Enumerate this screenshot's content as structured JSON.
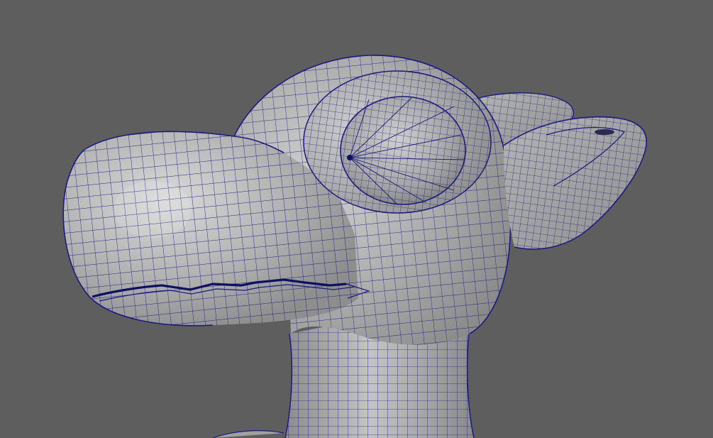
{
  "viewport": {
    "background_color": "#5e5e5e",
    "model": {
      "name": "cartoon-creature-head",
      "shading": "smooth-shaded-with-wireframe",
      "surface_color": "#a7a7a7",
      "highlight_color": "#d2d2d2",
      "wireframe_color": "#1a1a80"
    }
  }
}
